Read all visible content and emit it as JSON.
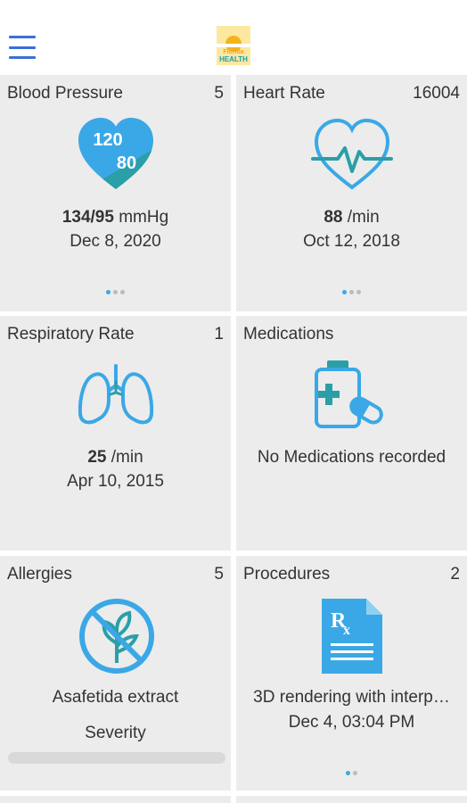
{
  "header": {
    "logo_line1": "Florida",
    "logo_line2": "HEALTH"
  },
  "cards": {
    "blood_pressure": {
      "title": "Blood Pressure",
      "count": "5",
      "icon_top": "120",
      "icon_bottom": "80",
      "value": "134/95",
      "unit": " mmHg",
      "date": "Dec 8, 2020"
    },
    "heart_rate": {
      "title": "Heart Rate",
      "count": "16004",
      "value": "88",
      "unit": " /min",
      "date": "Oct 12, 2018"
    },
    "respiratory_rate": {
      "title": "Respiratory Rate",
      "count": "1",
      "value": "25",
      "unit": " /min",
      "date": "Apr 10, 2015"
    },
    "medications": {
      "title": "Medications",
      "message": "No Medications recorded"
    },
    "allergies": {
      "title": "Allergies",
      "count": "5",
      "name": "Asafetida extract",
      "severity_label": "Severity"
    },
    "procedures": {
      "title": "Procedures",
      "count": "2",
      "name": "3D rendering with interp…",
      "date": "Dec 4, 03:04 PM"
    }
  },
  "icons": {
    "menu": "menu-icon",
    "bp": "heart-bp-icon",
    "hr": "heart-pulse-icon",
    "lungs": "lungs-icon",
    "meds": "pill-bottle-icon",
    "allergy": "no-plant-icon",
    "procedure": "prescription-icon"
  },
  "colors": {
    "accent_blue": "#3aa8e6",
    "teal": "#2a9fa8",
    "card_bg": "#ececec"
  }
}
